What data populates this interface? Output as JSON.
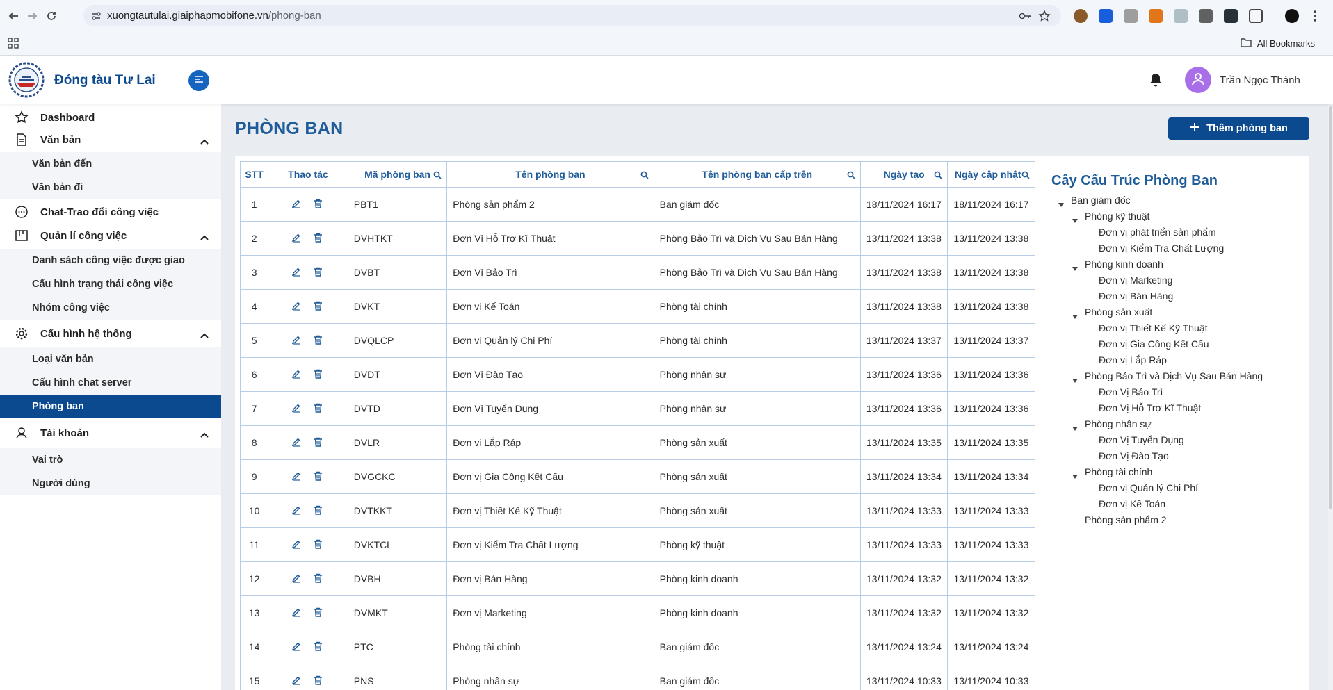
{
  "browser": {
    "url_host": "xuongtautulai.giaiphapmobifone.vn",
    "url_path": "/phong-ban",
    "all_bookmarks": "All Bookmarks"
  },
  "header": {
    "brand": "Đóng tàu Tư Lai",
    "user_name": "Trần Ngọc Thành"
  },
  "sidebar": {
    "dashboard": "Dashboard",
    "van_ban": "Văn bản",
    "van_ban_den": "Văn bản đến",
    "van_ban_di": "Văn bản đi",
    "chat": "Chat-Trao đổi công việc",
    "quan_li": "Quản lí công việc",
    "ds_cong_viec": "Danh sách công việc được giao",
    "cau_hinh_trang_thai": "Cấu hình trạng thái công việc",
    "nhom_cong_viec": "Nhóm công việc",
    "cau_hinh_he_thong": "Cấu hình hệ thống",
    "loai_van_ban": "Loại văn bản",
    "cau_hinh_chat": "Cấu hình chat server",
    "phong_ban": "Phòng ban",
    "tai_khoan": "Tài khoản",
    "vai_tro": "Vai trò",
    "nguoi_dung": "Người dùng"
  },
  "page": {
    "title": "PHÒNG BAN",
    "add_button": "Thêm phòng ban"
  },
  "table": {
    "headers": [
      "STT",
      "Thao tác",
      "Mã phòng ban",
      "Tên phòng ban",
      "Tên phòng ban cấp trên",
      "Ngày tạo",
      "Ngày cập nhật"
    ],
    "rows": [
      {
        "stt": "1",
        "ma": "PBT1",
        "ten": "Phòng sản phẩm 2",
        "cap_tren": "Ban giám đốc",
        "ngay_tao": "18/11/2024 16:17",
        "ngay_cap_nhat": "18/11/2024 16:17"
      },
      {
        "stt": "2",
        "ma": "DVHTKT",
        "ten": "Đơn Vị Hỗ Trợ Kĩ Thuật",
        "cap_tren": "Phòng Bảo Trì và Dịch Vụ Sau Bán Hàng",
        "ngay_tao": "13/11/2024 13:38",
        "ngay_cap_nhat": "13/11/2024 13:38"
      },
      {
        "stt": "3",
        "ma": "DVBT",
        "ten": "Đơn Vị Bảo Trì",
        "cap_tren": "Phòng Bảo Trì và Dịch Vụ Sau Bán Hàng",
        "ngay_tao": "13/11/2024 13:38",
        "ngay_cap_nhat": "13/11/2024 13:38"
      },
      {
        "stt": "4",
        "ma": "DVKT",
        "ten": "Đơn vị Kế Toán",
        "cap_tren": "Phòng tài chính",
        "ngay_tao": "13/11/2024 13:38",
        "ngay_cap_nhat": "13/11/2024 13:38"
      },
      {
        "stt": "5",
        "ma": "DVQLCP",
        "ten": "Đơn vị Quản lý Chi Phí",
        "cap_tren": "Phòng tài chính",
        "ngay_tao": "13/11/2024 13:37",
        "ngay_cap_nhat": "13/11/2024 13:37"
      },
      {
        "stt": "6",
        "ma": "DVDT",
        "ten": "Đơn Vị Đào Tạo",
        "cap_tren": "Phòng nhân sự",
        "ngay_tao": "13/11/2024 13:36",
        "ngay_cap_nhat": "13/11/2024 13:36"
      },
      {
        "stt": "7",
        "ma": "DVTD",
        "ten": "Đơn Vị Tuyển Dụng",
        "cap_tren": "Phòng nhân sự",
        "ngay_tao": "13/11/2024 13:36",
        "ngay_cap_nhat": "13/11/2024 13:36"
      },
      {
        "stt": "8",
        "ma": "DVLR",
        "ten": "Đơn vị Lắp Ráp",
        "cap_tren": "Phòng sản xuất",
        "ngay_tao": "13/11/2024 13:35",
        "ngay_cap_nhat": "13/11/2024 13:35"
      },
      {
        "stt": "9",
        "ma": "DVGCKC",
        "ten": "Đơn vị Gia Công Kết Cấu",
        "cap_tren": "Phòng sản xuất",
        "ngay_tao": "13/11/2024 13:34",
        "ngay_cap_nhat": "13/11/2024 13:34"
      },
      {
        "stt": "10",
        "ma": "DVTKKT",
        "ten": "Đơn vị Thiết Kế Kỹ Thuật",
        "cap_tren": "Phòng sản xuất",
        "ngay_tao": "13/11/2024 13:33",
        "ngay_cap_nhat": "13/11/2024 13:33"
      },
      {
        "stt": "11",
        "ma": "DVKTCL",
        "ten": "Đơn vị Kiểm Tra Chất Lượng",
        "cap_tren": "Phòng kỹ thuật",
        "ngay_tao": "13/11/2024 13:33",
        "ngay_cap_nhat": "13/11/2024 13:33"
      },
      {
        "stt": "12",
        "ma": "DVBH",
        "ten": "Đơn vị Bán Hàng",
        "cap_tren": "Phòng kinh doanh",
        "ngay_tao": "13/11/2024 13:32",
        "ngay_cap_nhat": "13/11/2024 13:32"
      },
      {
        "stt": "13",
        "ma": "DVMKT",
        "ten": "Đơn vị Marketing",
        "cap_tren": "Phòng kinh doanh",
        "ngay_tao": "13/11/2024 13:32",
        "ngay_cap_nhat": "13/11/2024 13:32"
      },
      {
        "stt": "14",
        "ma": "PTC",
        "ten": "Phòng tài chính",
        "cap_tren": "Ban giám đốc",
        "ngay_tao": "13/11/2024 13:24",
        "ngay_cap_nhat": "13/11/2024 13:24"
      },
      {
        "stt": "15",
        "ma": "PNS",
        "ten": "Phòng nhân sự",
        "cap_tren": "Ban giám đốc",
        "ngay_tao": "13/11/2024 10:33",
        "ngay_cap_nhat": "13/11/2024 10:33"
      }
    ]
  },
  "tree": {
    "title": "Cây Cấu Trúc Phòng Ban",
    "root": "Ban giám đốc",
    "items": [
      {
        "label": "Phòng kỹ thuật",
        "level": 1,
        "expanded": true
      },
      {
        "label": "Đơn vị phát triển sản phẩm",
        "level": 2
      },
      {
        "label": "Đơn vị Kiểm Tra Chất Lượng",
        "level": 2
      },
      {
        "label": "Phòng kinh doanh",
        "level": 1,
        "expanded": true
      },
      {
        "label": "Đơn vị Marketing",
        "level": 2
      },
      {
        "label": "Đơn vị Bán Hàng",
        "level": 2
      },
      {
        "label": "Phòng sản xuất",
        "level": 1,
        "expanded": true
      },
      {
        "label": "Đơn vị Thiết Kế Kỹ Thuật",
        "level": 2
      },
      {
        "label": "Đơn vị Gia Công Kết Cấu",
        "level": 2
      },
      {
        "label": "Đơn vị Lắp Ráp",
        "level": 2
      },
      {
        "label": "Phòng Bảo Trì và Dịch Vụ Sau Bán Hàng",
        "level": 1,
        "expanded": true
      },
      {
        "label": "Đơn Vị Bảo Trì",
        "level": 2
      },
      {
        "label": "Đơn Vị Hỗ Trợ Kĩ Thuật",
        "level": 2
      },
      {
        "label": "Phòng nhân sự",
        "level": 1,
        "expanded": true
      },
      {
        "label": "Đơn Vị Tuyển Dụng",
        "level": 2
      },
      {
        "label": "Đơn Vị Đào Tạo",
        "level": 2
      },
      {
        "label": "Phòng tài chính",
        "level": 1,
        "expanded": true
      },
      {
        "label": "Đơn vị Quản lý Chi Phí",
        "level": 2
      },
      {
        "label": "Đơn vị Kế Toán",
        "level": 2
      },
      {
        "label": "Phòng sản phẩm 2",
        "level": 1,
        "expanded": false
      }
    ]
  },
  "colors": {
    "primary": "#0b4a8f",
    "title": "#1f5c99",
    "avatar": "#a96fe8"
  },
  "icons": [
    "back-icon",
    "forward-icon",
    "reload-icon",
    "site-info-icon",
    "key-icon",
    "star-icon",
    "apps-icon",
    "folder-icon",
    "menu-toggle-icon",
    "bell-icon",
    "user-icon",
    "dashboard-star-icon",
    "document-icon",
    "chat-icon",
    "kanban-icon",
    "gear-icon",
    "person-icon",
    "chevron-up-icon",
    "plus-icon",
    "search-icon",
    "edit-icon",
    "trash-icon",
    "caret-down-icon"
  ]
}
